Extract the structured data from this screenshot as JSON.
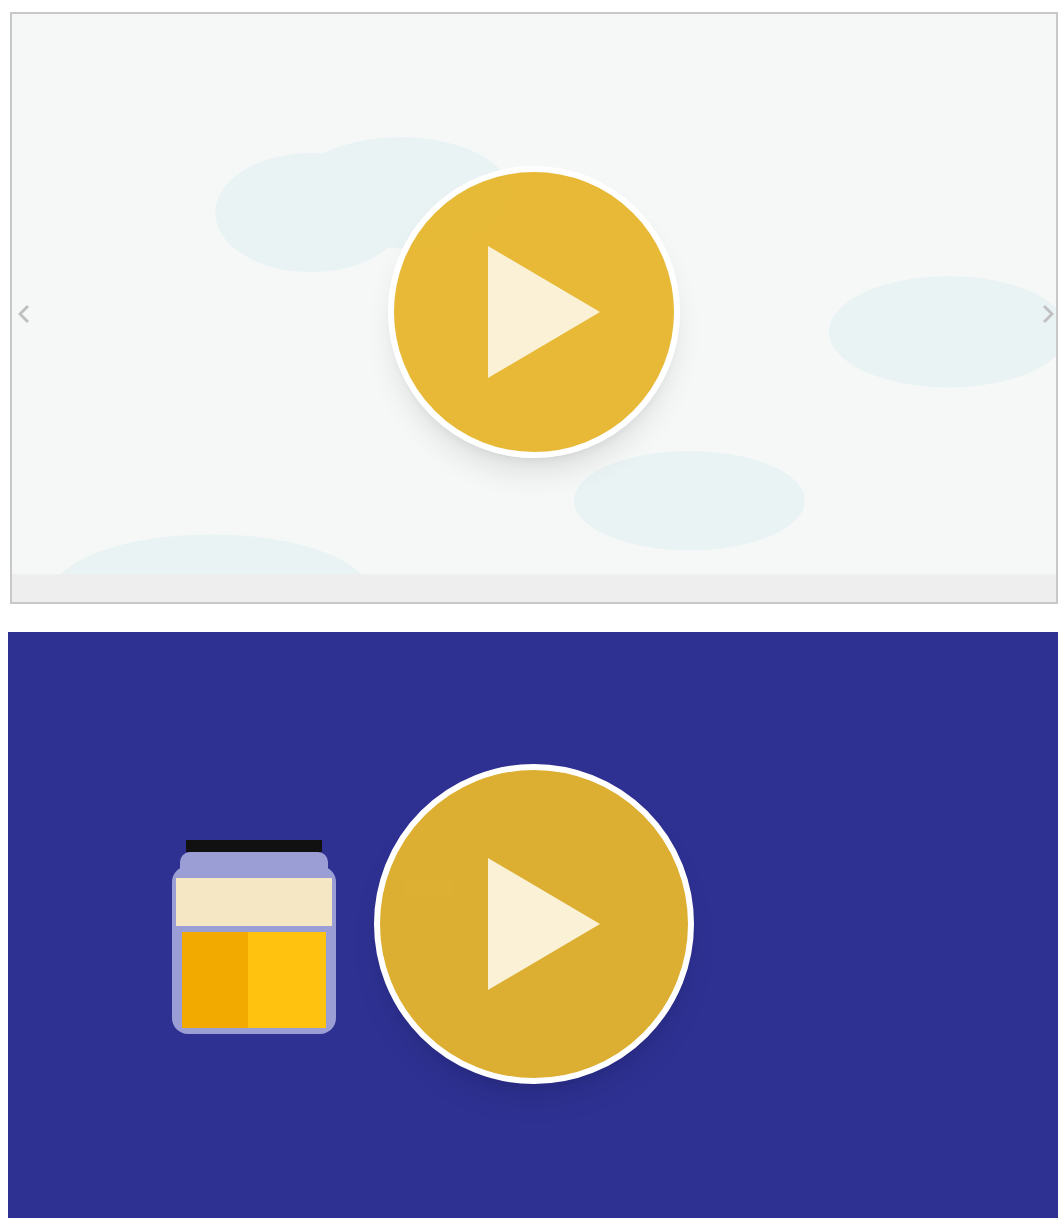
{
  "videos": [
    {
      "kind": "picture",
      "nav_arrows": true
    },
    {
      "kind": "picture",
      "nav_arrows": false
    }
  ]
}
